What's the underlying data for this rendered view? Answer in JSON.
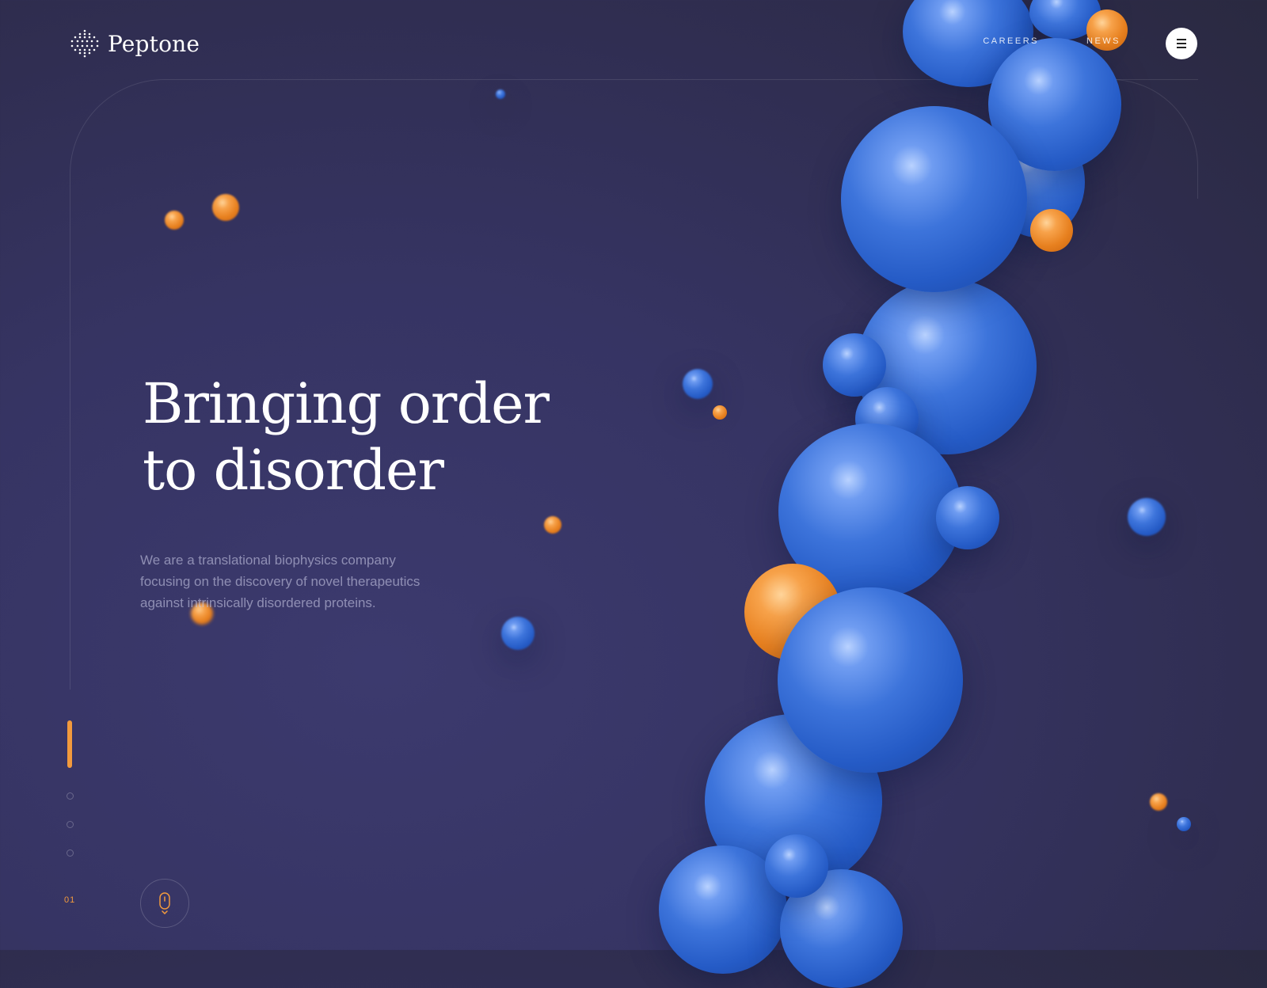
{
  "brand": {
    "name": "Peptone"
  },
  "nav": {
    "items": [
      {
        "label": "CAREERS"
      },
      {
        "label": "NEWS"
      }
    ]
  },
  "hero": {
    "headline_line1": "Bringing order",
    "headline_line2": "to disorder",
    "description": "We are a translational biophysics company focusing on the discovery of novel therapeutics against intrinsically disordered proteins."
  },
  "pager": {
    "current": "01",
    "total_slides": 4,
    "active_index": 0
  },
  "colors": {
    "accent": "#f29a3d",
    "background": "#363463",
    "sphere_blue": "#3d74db",
    "sphere_orange": "#e7801f"
  },
  "icons": {
    "menu": "hamburger-icon",
    "scroll": "mouse-scroll-icon",
    "logo": "peptone-molecule-icon"
  }
}
